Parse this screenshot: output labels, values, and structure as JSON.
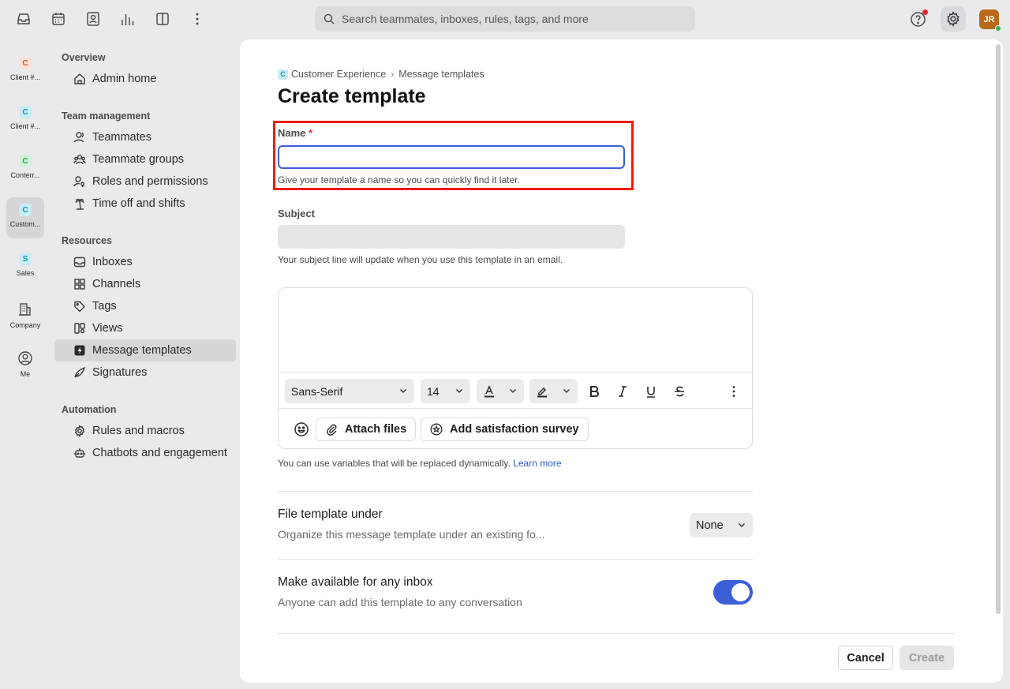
{
  "search": {
    "placeholder": "Search teammates, inboxes, rules, tags, and more"
  },
  "user": {
    "initials": "JR"
  },
  "rail": [
    {
      "label": "Client #...",
      "badge": "C",
      "badge_bg": "#fde2d8",
      "badge_fg": "#e0552b"
    },
    {
      "label": "Client #...",
      "badge": "C",
      "badge_bg": "#c9edf5",
      "badge_fg": "#1596b0"
    },
    {
      "label": "Conterr...",
      "badge": "C",
      "badge_bg": "#d2f2dc",
      "badge_fg": "#24a049"
    },
    {
      "label": "Custom...",
      "badge": "C",
      "badge_bg": "#c9edf5",
      "badge_fg": "#1596b0"
    },
    {
      "label": "Sales",
      "badge": "S",
      "badge_bg": "#c9edf5",
      "badge_fg": "#1596b0"
    },
    {
      "label": "Company",
      "icon": "building-icon"
    },
    {
      "label": "Me",
      "icon": "person-circle-icon"
    }
  ],
  "nav": {
    "overview": {
      "heading": "Overview",
      "items": [
        "Admin home"
      ]
    },
    "team": {
      "heading": "Team management",
      "items": [
        "Teammates",
        "Teammate groups",
        "Roles and permissions",
        "Time off and shifts"
      ]
    },
    "resources": {
      "heading": "Resources",
      "items": [
        "Inboxes",
        "Channels",
        "Tags",
        "Views",
        "Message templates",
        "Signatures"
      ]
    },
    "automation": {
      "heading": "Automation",
      "items": [
        "Rules and macros",
        "Chatbots and engagement"
      ]
    }
  },
  "breadcrumb": {
    "badge": "C",
    "workspace": "Customer Experience",
    "page": "Message templates"
  },
  "title": "Create template",
  "form": {
    "name_label": "Name",
    "name_required": "*",
    "name_value": "",
    "name_helper": "Give your template a name so you can quickly find it later.",
    "subject_label": "Subject",
    "subject_helper": "Your subject line will update when you use this template in an email."
  },
  "editor": {
    "font": "Sans-Serif",
    "size": "14",
    "attach_label": "Attach files",
    "survey_label": "Add satisfaction survey",
    "vars_text": "You can use variables that will be replaced dynamically.",
    "learn_more": "Learn more"
  },
  "file_under": {
    "title": "File template under",
    "subtitle": "Organize this message template under an existing fo...",
    "value": "None"
  },
  "availability": {
    "title": "Make available for any inbox",
    "subtitle": "Anyone can add this template to any conversation",
    "enabled": true
  },
  "actions": {
    "cancel": "Cancel",
    "create": "Create"
  },
  "colors": {
    "accent": "#3c5fd7",
    "highlight_box": "#ee1c0e"
  }
}
